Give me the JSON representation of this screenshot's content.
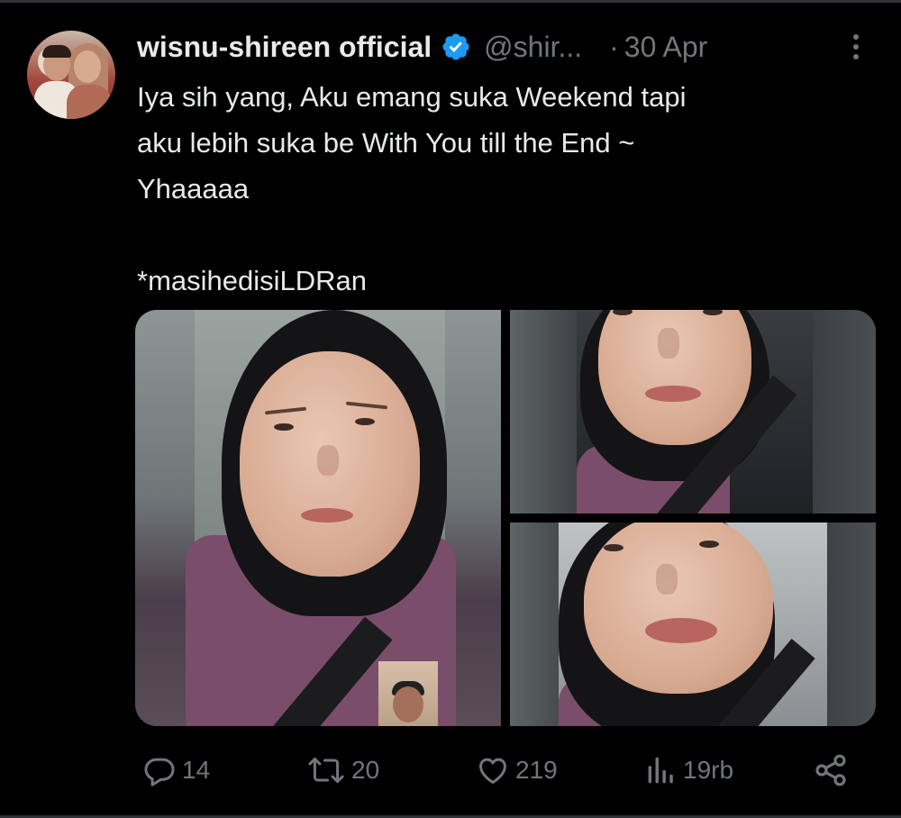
{
  "author": {
    "display_name": "wisnu-shireen official",
    "handle": "@shir...",
    "separator": "·",
    "date": "30 Apr",
    "verified": true,
    "verified_color": "#1d9bf0"
  },
  "tweet": {
    "lines": [
      "Iya sih yang, Aku emang suka Weekend tapi",
      "aku lebih suka be With You till the End ~",
      "Yhaaaaa",
      "",
      "*masihedisiLDRan"
    ]
  },
  "media": {
    "count": 3
  },
  "actions": {
    "reply": {
      "icon": "reply-icon",
      "count": "14"
    },
    "repost": {
      "icon": "repost-icon",
      "count": "20"
    },
    "like": {
      "icon": "heart-icon",
      "count": "219"
    },
    "views": {
      "icon": "views-icon",
      "count": "19rb"
    },
    "share": {
      "icon": "share-icon"
    }
  },
  "colors": {
    "background": "#000000",
    "text": "#e7e9ea",
    "muted": "#71767b"
  }
}
